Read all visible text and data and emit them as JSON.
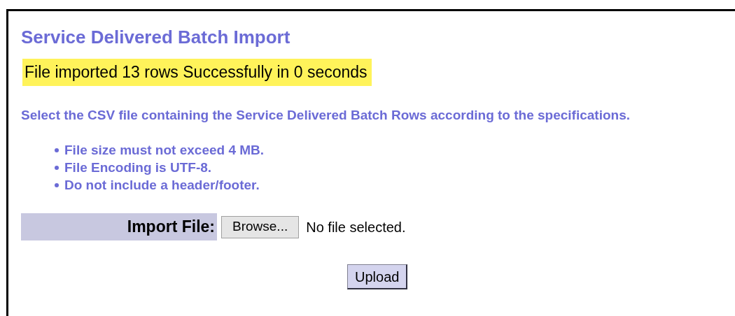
{
  "title": "Service Delivered Batch Import",
  "message": "File imported 13 rows Successfully in 0 seconds",
  "instructions": "Select the CSV file containing the Service Delivered Batch Rows according to the specifications.",
  "specifications": [
    "File size must not exceed 4 MB.",
    "File Encoding is UTF-8.",
    "Do not include a header/footer."
  ],
  "import_file": {
    "label": "Import File:",
    "browse_button": "Browse...",
    "file_status": "No file selected."
  },
  "upload_button": "Upload"
}
